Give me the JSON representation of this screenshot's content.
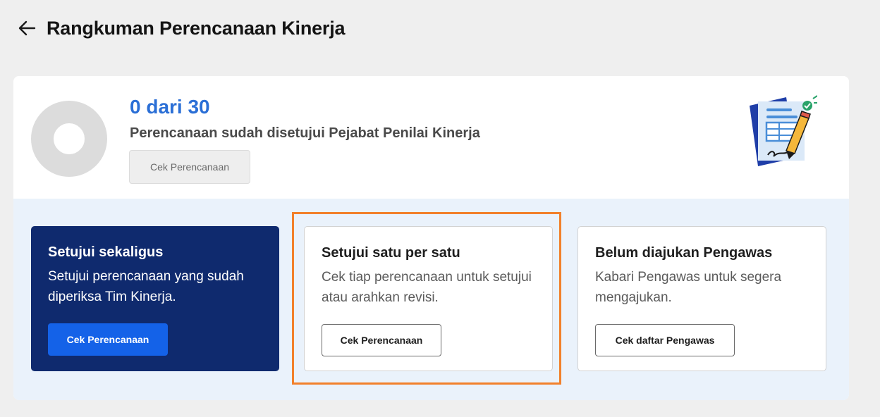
{
  "header": {
    "title": "Rangkuman Perencanaan Kinerja",
    "back_icon": "arrow-left-icon"
  },
  "summary": {
    "count_text": "0 dari 30",
    "approved": 0,
    "total": 30,
    "description": "Perencanaan sudah disetujui Pejabat Penilai Kinerja",
    "button_label": "Cek Perencanaan",
    "illustration_icon": "document-signature-icon"
  },
  "options": [
    {
      "title": "Setujui sekaligus",
      "description": "Setujui perencanaan yang sudah diperiksa Tim Kinerja.",
      "button_label": "Cek Perencanaan"
    },
    {
      "title": "Setujui satu per satu",
      "description": "Cek tiap perencanaan untuk setujui atau arahkan revisi.",
      "button_label": "Cek Perencanaan"
    },
    {
      "title": "Belum diajukan Pengawas",
      "description": "Kabari Pengawas untuk segera mengajukan.",
      "button_label": "Cek daftar Pengawas"
    }
  ],
  "colors": {
    "primary": "#1462e8",
    "navy": "#0f2a6e",
    "count_blue": "#2b6fd6",
    "highlight": "#f2802b",
    "section_bg": "#eaf2fb"
  }
}
